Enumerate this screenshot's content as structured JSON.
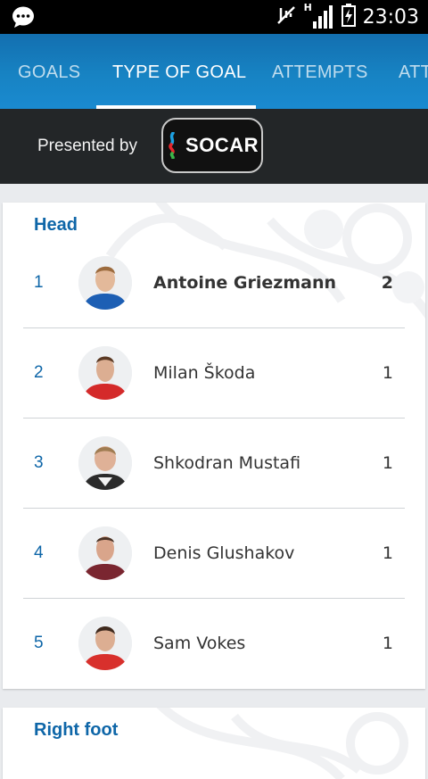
{
  "status_bar": {
    "time": "23:03",
    "network_label": "H",
    "icons": [
      "chat-bubble-icon",
      "mute-icon",
      "signal-icon",
      "battery-charging-icon"
    ]
  },
  "tabs": [
    {
      "label": "GOALS",
      "active": false
    },
    {
      "label": "TYPE OF GOAL",
      "active": true
    },
    {
      "label": "ATTEMPTS",
      "active": false
    },
    {
      "label": "ATT",
      "active": false
    }
  ],
  "sponsor": {
    "presented_by": "Presented by",
    "brand": "SOCAR"
  },
  "sections": [
    {
      "title": "Head",
      "players": [
        {
          "rank": "1",
          "name": "Antoine Griezmann",
          "goals": "2",
          "highlight": true,
          "kit": "#1d5fb4"
        },
        {
          "rank": "2",
          "name": "Milan Škoda",
          "goals": "1",
          "highlight": false,
          "kit": "#d42a2a"
        },
        {
          "rank": "3",
          "name": "Shkodran Mustafi",
          "goals": "1",
          "highlight": false,
          "kit": "#2b2b2b"
        },
        {
          "rank": "4",
          "name": "Denis Glushakov",
          "goals": "1",
          "highlight": false,
          "kit": "#7a2630"
        },
        {
          "rank": "5",
          "name": "Sam Vokes",
          "goals": "1",
          "highlight": false,
          "kit": "#d8302c"
        }
      ]
    },
    {
      "title": "Right foot",
      "players": []
    }
  ],
  "colors": {
    "accent_blue": "#0e66a8",
    "tab_bar": "#1783c3",
    "sponsor_bar": "#232628"
  }
}
